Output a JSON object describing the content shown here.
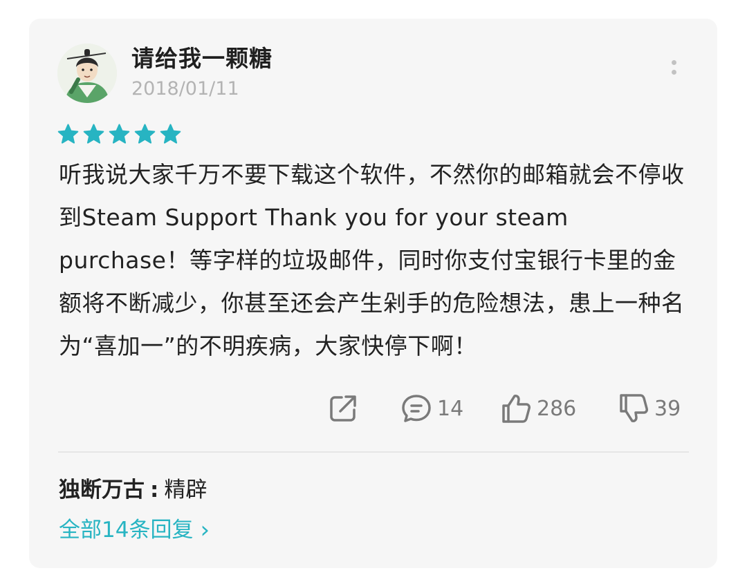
{
  "review": {
    "username": "请给我一颗糖",
    "date": "2018/01/11",
    "rating": 5,
    "rating_max": 5,
    "text": "听我说大家千万不要下载这个软件，不然你的邮箱就会不停收到Steam Support Thank you for your steam purchase！等字样的垃圾邮件，同时你支付宝银行卡里的金额将不断减少，你甚至还会产生剁手的危险想法，患上一种名为“喜加一”的不明疾病，大家快停下啊！"
  },
  "actions": {
    "share_icon": "share-icon",
    "comment_count": "14",
    "like_count": "286",
    "dislike_count": "39"
  },
  "replies": {
    "first_author": "独断万古",
    "separator": ":",
    "first_text": "精辟",
    "all_link": "全部14条回复",
    "chevron": "›"
  },
  "colors": {
    "star": "#27b4c2",
    "accent": "#27b4c2",
    "card_bg": "#f6f6f6"
  }
}
